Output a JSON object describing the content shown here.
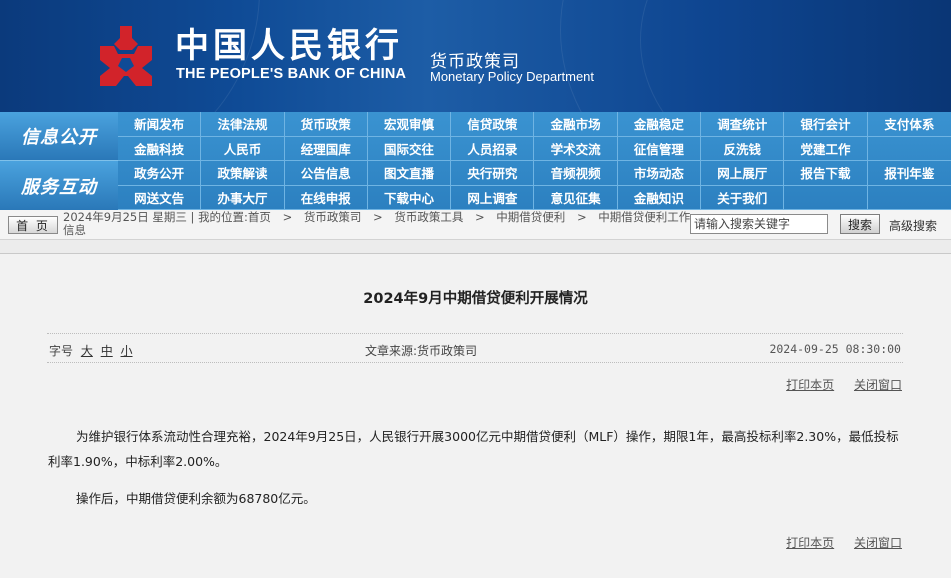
{
  "header": {
    "bank_name_cn": "中国人民银行",
    "bank_name_en": "THE PEOPLE'S BANK OF CHINA",
    "dept_cn": "货币政策司",
    "dept_en": "Monetary Policy Department",
    "logo_icon": "pboc-logo-icon",
    "colors": {
      "bg": "#0f4b96",
      "logo": "#d2232a"
    }
  },
  "nav": {
    "label_info": "信息公开",
    "label_service": "服务互动",
    "items": [
      "新闻发布",
      "法律法规",
      "货币政策",
      "宏观审慎",
      "信贷政策",
      "金融市场",
      "金融稳定",
      "调查统计",
      "银行会计",
      "支付体系",
      "金融科技",
      "人民币",
      "经理国库",
      "国际交往",
      "人员招录",
      "学术交流",
      "征信管理",
      "反洗钱",
      "党建工作",
      "",
      "政务公开",
      "政策解读",
      "公告信息",
      "图文直播",
      "央行研究",
      "音频视频",
      "市场动态",
      "网上展厅",
      "报告下载",
      "报刊年鉴",
      "网送文告",
      "办事大厅",
      "在线申报",
      "下载中心",
      "网上调查",
      "意见征集",
      "金融知识",
      "关于我们",
      "",
      ""
    ],
    "color": "#2d84c2"
  },
  "breadcrumb": {
    "home_label": "首 页",
    "date_text": "2024年9月25日 星期三",
    "location_text": "我的位置:首页",
    "sep": ">",
    "path": [
      "货币政策司",
      "货币政策工具",
      "中期借贷便利",
      "中期借贷便利工作信息"
    ]
  },
  "search": {
    "placeholder": "请输入搜索关键字",
    "button_label": "搜索",
    "advanced_label": "高级搜索"
  },
  "article": {
    "title": "2024年9月中期借贷便利开展情况",
    "font_size_label": "字号",
    "font_sizes": [
      "大",
      "中",
      "小"
    ],
    "source": "文章来源:货币政策司",
    "datetime": "2024-09-25 08:30:00",
    "print_label": "打印本页",
    "close_label": "关闭窗口",
    "paragraphs": [
      "为维护银行体系流动性合理充裕，2024年9月25日，人民银行开展3000亿元中期借贷便利（MLF）操作，期限1年，最高投标利率2.30%，最低投标利率1.90%，中标利率2.00%。",
      "操作后，中期借贷便利余额为68780亿元。"
    ]
  }
}
